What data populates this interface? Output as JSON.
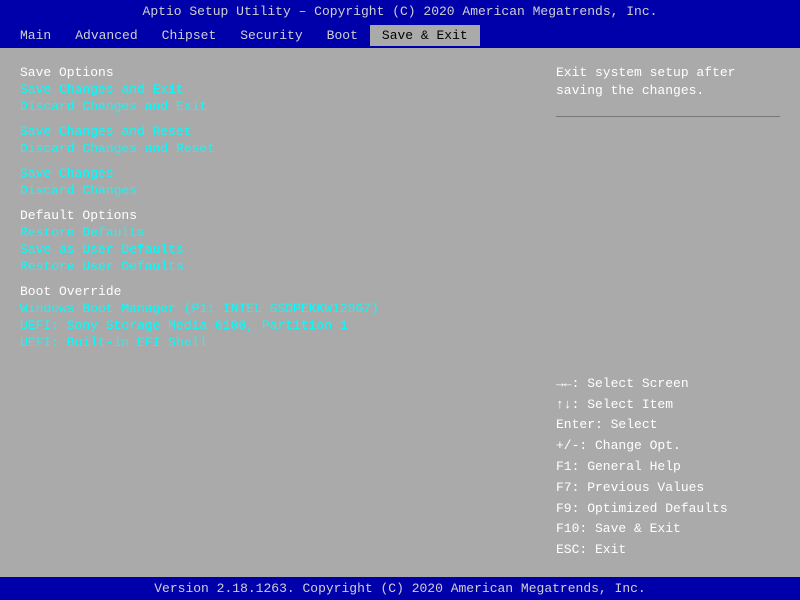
{
  "title_bar": {
    "text": "Aptio Setup Utility – Copyright (C) 2020 American Megatrends, Inc."
  },
  "menu_bar": {
    "items": [
      {
        "label": "Main",
        "active": false
      },
      {
        "label": "Advanced",
        "active": false
      },
      {
        "label": "Chipset",
        "active": false
      },
      {
        "label": "Security",
        "active": false
      },
      {
        "label": "Boot",
        "active": false
      },
      {
        "label": "Save & Exit",
        "active": true
      }
    ]
  },
  "left_panel": {
    "sections": [
      {
        "type": "header",
        "text": "Save Options"
      },
      {
        "type": "option",
        "text": "Save Changes and Exit"
      },
      {
        "type": "option",
        "text": "Discard Changes and Exit"
      },
      {
        "type": "spacer"
      },
      {
        "type": "option",
        "text": "Save Changes and Reset"
      },
      {
        "type": "option",
        "text": "Discard Changes and Reset"
      },
      {
        "type": "spacer"
      },
      {
        "type": "option",
        "text": "Save Changes"
      },
      {
        "type": "option",
        "text": "Discard Changes"
      },
      {
        "type": "spacer"
      },
      {
        "type": "header",
        "text": "Default Options"
      },
      {
        "type": "option",
        "text": "Restore Defaults"
      },
      {
        "type": "option",
        "text": "Save as User Defaults"
      },
      {
        "type": "option",
        "text": "Restore User Defaults"
      },
      {
        "type": "spacer"
      },
      {
        "type": "header",
        "text": "Boot Override"
      },
      {
        "type": "option",
        "text": "Windows Boot Manager (P1: INTEL SSDPEKKW128G7)"
      },
      {
        "type": "option",
        "text": "UEFI: Sony Storage Media 0100, Partition 1"
      },
      {
        "type": "option",
        "text": "UEFI: Built-in EFI Shell"
      }
    ]
  },
  "right_panel": {
    "description": "Exit system setup after saving the changes.",
    "key_help": [
      "→←: Select Screen",
      "↑↓: Select Item",
      "Enter: Select",
      "+/-: Change Opt.",
      "F1: General Help",
      "F7: Previous Values",
      "F9: Optimized Defaults",
      "F10: Save & Exit",
      "ESC: Exit"
    ]
  },
  "status_bar": {
    "text": "Version 2.18.1263. Copyright (C) 2020 American Megatrends, Inc."
  }
}
